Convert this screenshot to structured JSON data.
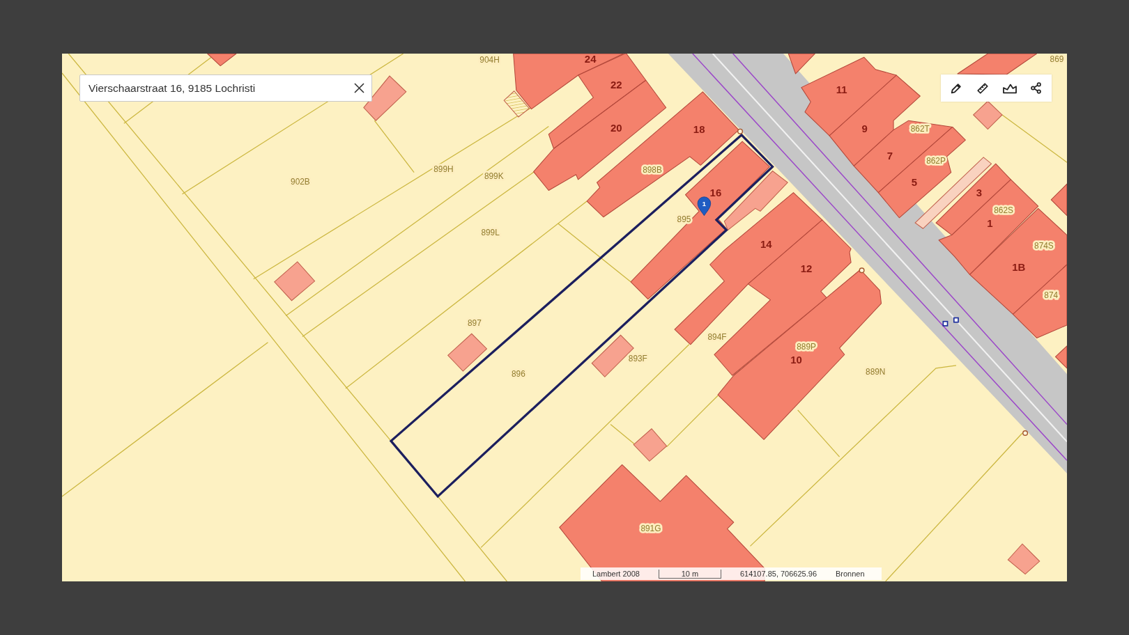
{
  "search": {
    "value": "Vierschaarstraat 16, 9185 Lochristi"
  },
  "map": {
    "labels": [
      {
        "text": "904H",
        "kind": "parcel_number"
      },
      {
        "text": "24",
        "kind": "house_number"
      },
      {
        "text": "22",
        "kind": "house_number"
      },
      {
        "text": "20",
        "kind": "house_number"
      },
      {
        "text": "18",
        "kind": "house_number"
      },
      {
        "text": "16",
        "kind": "house_number"
      },
      {
        "text": "14",
        "kind": "house_number"
      },
      {
        "text": "12",
        "kind": "house_number"
      },
      {
        "text": "10",
        "kind": "house_number"
      },
      {
        "text": "11",
        "kind": "house_number"
      },
      {
        "text": "9",
        "kind": "house_number"
      },
      {
        "text": "7",
        "kind": "house_number"
      },
      {
        "text": "5",
        "kind": "house_number"
      },
      {
        "text": "3",
        "kind": "house_number"
      },
      {
        "text": "1",
        "kind": "house_number"
      },
      {
        "text": "1B",
        "kind": "house_number"
      },
      {
        "text": "902B",
        "kind": "parcel_number"
      },
      {
        "text": "899H",
        "kind": "parcel_number"
      },
      {
        "text": "899K",
        "kind": "parcel_number"
      },
      {
        "text": "899L",
        "kind": "parcel_number"
      },
      {
        "text": "898B",
        "kind": "parcel_number"
      },
      {
        "text": "895",
        "kind": "parcel_number"
      },
      {
        "text": "897",
        "kind": "parcel_number"
      },
      {
        "text": "896",
        "kind": "parcel_number"
      },
      {
        "text": "893F",
        "kind": "parcel_number"
      },
      {
        "text": "894F",
        "kind": "parcel_number"
      },
      {
        "text": "889P",
        "kind": "parcel_number"
      },
      {
        "text": "889N",
        "kind": "parcel_number"
      },
      {
        "text": "891G",
        "kind": "parcel_number"
      },
      {
        "text": "862T",
        "kind": "parcel_number"
      },
      {
        "text": "862P",
        "kind": "parcel_number"
      },
      {
        "text": "862S",
        "kind": "parcel_number"
      },
      {
        "text": "874S",
        "kind": "parcel_number"
      },
      {
        "text": "874",
        "kind": "parcel_number"
      },
      {
        "text": "869",
        "kind": "parcel_number"
      }
    ],
    "marker": {
      "label": "1"
    }
  },
  "status_bar": {
    "projection": "Lambert 2008",
    "scale": "10 m",
    "coordinates": "614107.85, 706625.96",
    "sources": "Bronnen"
  }
}
